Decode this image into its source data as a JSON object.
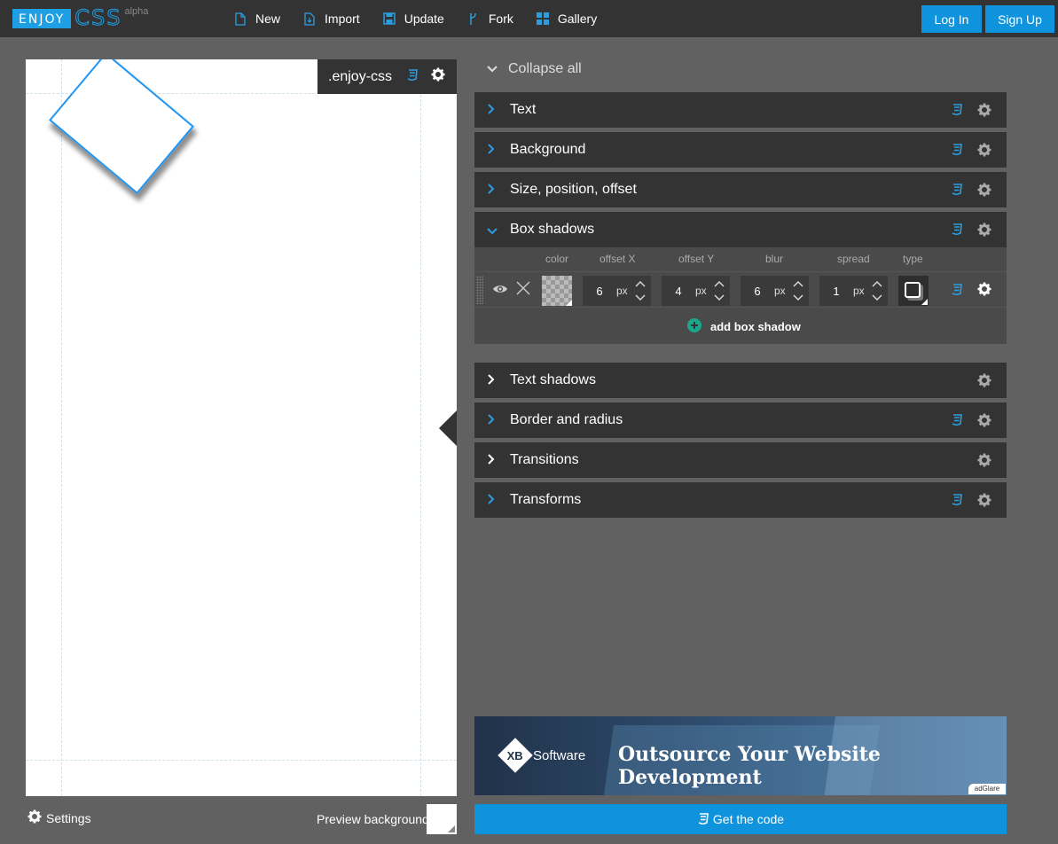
{
  "logo": {
    "enjoy": "ENJOY",
    "css": "CSS",
    "badge": "alpha"
  },
  "nav": [
    {
      "label": "New",
      "icon": "file-icon"
    },
    {
      "label": "Import",
      "icon": "import-icon"
    },
    {
      "label": "Update",
      "icon": "save-icon"
    },
    {
      "label": "Fork",
      "icon": "fork-icon"
    },
    {
      "label": "Gallery",
      "icon": "grid-icon"
    }
  ],
  "auth": {
    "login": "Log In",
    "signup": "Sign Up"
  },
  "preview": {
    "selector": ".enjoy-css"
  },
  "bottom": {
    "settings": "Settings",
    "preview_background": "Preview background"
  },
  "collapse_all": "Collapse all",
  "panels": {
    "text": "Text",
    "background": "Background",
    "size": "Size, position, offset",
    "box_shadows": "Box shadows",
    "text_shadows": "Text shadows",
    "border": "Border and radius",
    "transitions": "Transitions",
    "transforms": "Transforms"
  },
  "box_shadow": {
    "columns": {
      "color": "color",
      "offset_x": "offset X",
      "offset_y": "offset Y",
      "blur": "blur",
      "spread": "spread",
      "type": "type"
    },
    "offset_x": "6",
    "offset_y": "4",
    "blur": "6",
    "spread": "1",
    "unit": "px",
    "add_label": "add box shadow"
  },
  "ad": {
    "brand": "Software",
    "brand_mark": "XB",
    "headline": "Outsource Your Website Development",
    "network": "adGlare"
  },
  "get_code": "Get the code",
  "colors": {
    "accent": "#0f93dc",
    "panel": "#333333",
    "background": "#616161",
    "shape_border": "#2196f3"
  }
}
